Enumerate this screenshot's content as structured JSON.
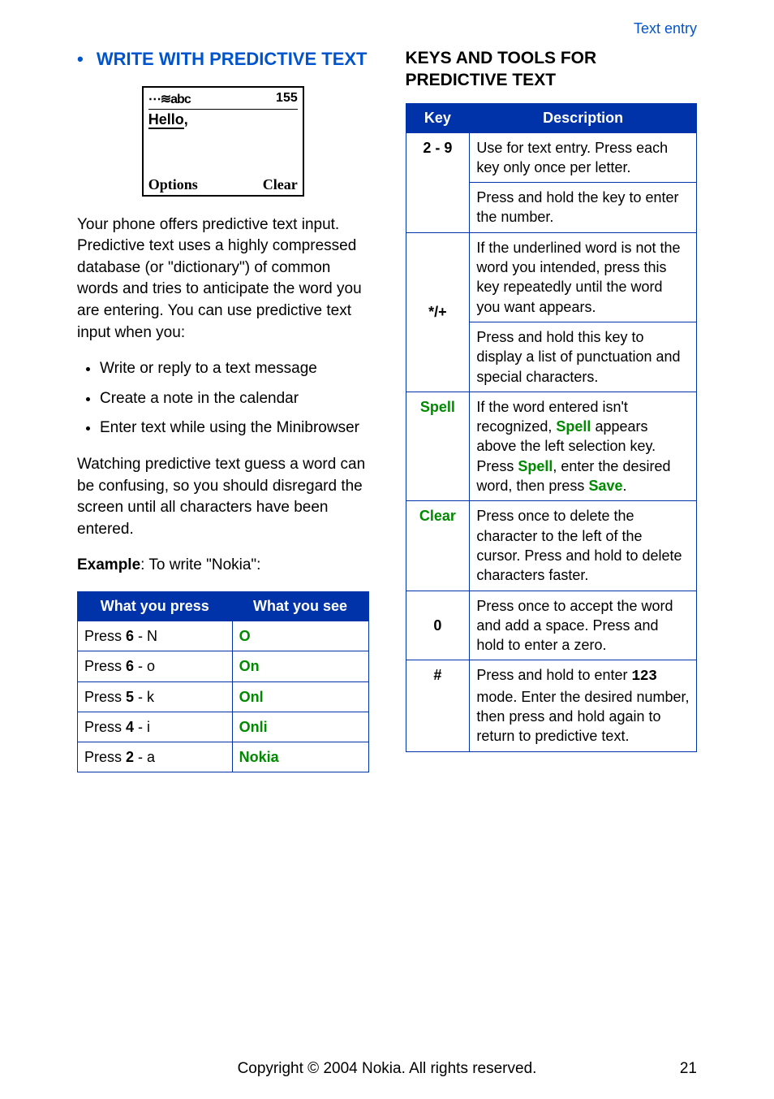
{
  "header_link": "Text entry",
  "left": {
    "title": "WRITE WITH PREDICTIVE TEXT",
    "phone": {
      "top_icon": "⋯≋abc",
      "top_count": "155",
      "word": "Hello",
      "options": "Options",
      "clear": "Clear"
    },
    "intro": "Your phone offers predictive text input. Predictive text uses a highly compressed database (or \"dictionary\") of common words and tries to anticipate the word you are entering. You can use predictive text input when you:",
    "bullets": [
      "Write or reply to a text message",
      "Create a note in the calendar",
      "Enter text while using the Minibrowser"
    ],
    "watching": "Watching predictive text guess a word can be confusing, so you should disregard the screen until all characters have been entered.",
    "example_label": "Example",
    "example_text": ": To write \"Nokia\":",
    "table_headers": {
      "press": "What you press",
      "see": "What you see"
    },
    "rows": [
      {
        "press_pre": "Press ",
        "press_key": "6",
        "press_suf": " - N",
        "see": "O"
      },
      {
        "press_pre": "Press ",
        "press_key": "6",
        "press_suf": " - o",
        "see": "On"
      },
      {
        "press_pre": "Press ",
        "press_key": "5",
        "press_suf": " - k",
        "see": "Onl"
      },
      {
        "press_pre": "Press ",
        "press_key": "4",
        "press_suf": " - i",
        "see": "Onli"
      },
      {
        "press_pre": "Press ",
        "press_key": "2",
        "press_suf": " - a",
        "see": "Nokia"
      }
    ]
  },
  "right": {
    "title": "KEYS AND TOOLS FOR PREDICTIVE TEXT",
    "table_headers": {
      "key": "Key",
      "desc": "Description"
    },
    "rows": {
      "r1": {
        "key": "2 - 9",
        "p1": "Use for text entry. Press each key only once per letter.",
        "p2": "Press and hold the key to enter the number."
      },
      "r2": {
        "key": "*/+",
        "p1": "If the underlined word is not the word you intended, press this key repeatedly until the word you want appears.",
        "p2": "Press and hold this key to display a list of punctuation and special characters."
      },
      "r3": {
        "key": "Spell",
        "t1": "If the word entered isn't recognized, ",
        "spell1": "Spell",
        "t2": " appears above the left selection key. Press ",
        "spell2": "Spell",
        "t3": ", enter the desired word, then press ",
        "save": "Save",
        "t4": "."
      },
      "r4": {
        "key": "Clear",
        "desc": "Press once to delete the character to the left of the cursor. Press and hold to delete characters faster."
      },
      "r5": {
        "key": "0",
        "desc": "Press once to accept the word and add a space. Press and hold to enter a zero."
      },
      "r6": {
        "key": "#",
        "t1": "Press and hold to enter ",
        "num": "123",
        "t2": " mode. Enter the desired number, then press and hold again to return to predictive text."
      }
    }
  },
  "footer": {
    "copyright": "Copyright © 2004 Nokia. All rights reserved.",
    "page": "21"
  }
}
